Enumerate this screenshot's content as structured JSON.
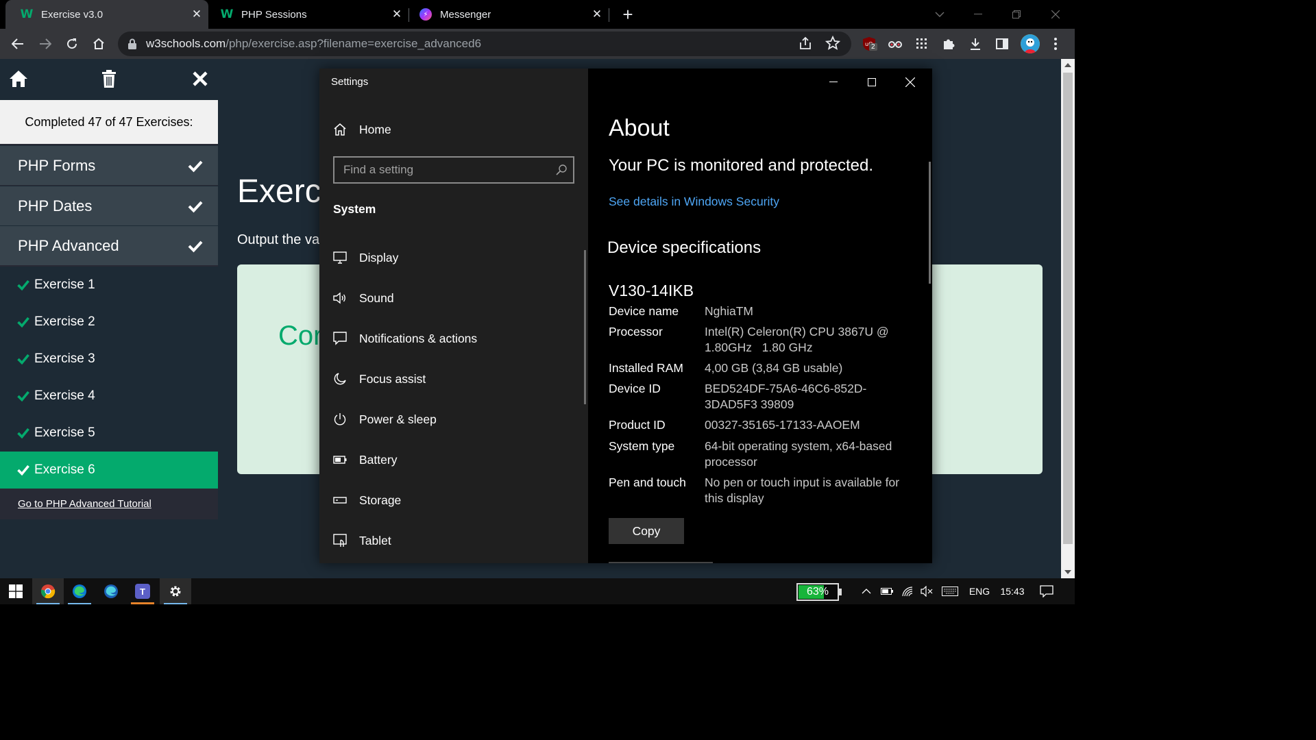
{
  "browser": {
    "tabs": [
      {
        "title": "Exercise v3.0",
        "favicon": "w3schools-icon",
        "active": true
      },
      {
        "title": "PHP Sessions",
        "favicon": "w3schools-icon",
        "active": false
      },
      {
        "title": "Messenger",
        "favicon": "messenger-icon",
        "active": false
      }
    ],
    "favicon_letter": "W",
    "url_host": "w3schools.com",
    "url_path": "/php/exercise.asp?filename=exercise_advanced6",
    "extension_badge": "2"
  },
  "sidebar": {
    "completed_text": "Completed 47 of 47 Exercises:",
    "categories": [
      {
        "label": "PHP Forms"
      },
      {
        "label": "PHP Dates"
      },
      {
        "label": "PHP Advanced"
      }
    ],
    "exercises": [
      {
        "label": "Exercise 1",
        "active": false
      },
      {
        "label": "Exercise 2",
        "active": false
      },
      {
        "label": "Exercise 3",
        "active": false
      },
      {
        "label": "Exercise 4",
        "active": false
      },
      {
        "label": "Exercise 5",
        "active": false
      },
      {
        "label": "Exercise 6",
        "active": true
      }
    ],
    "tutorial_link": "Go to PHP Advanced Tutorial"
  },
  "main": {
    "title_visible": "Exerc",
    "description_visible": "Output the va",
    "result_visible": "Cor"
  },
  "settings": {
    "window_title": "Settings",
    "home_label": "Home",
    "search_placeholder": "Find a setting",
    "section_header": "System",
    "nav_items": [
      {
        "label": "Display",
        "icon": "display-icon"
      },
      {
        "label": "Sound",
        "icon": "sound-icon"
      },
      {
        "label": "Notifications & actions",
        "icon": "notifications-icon"
      },
      {
        "label": "Focus assist",
        "icon": "focus-assist-icon"
      },
      {
        "label": "Power & sleep",
        "icon": "power-icon"
      },
      {
        "label": "Battery",
        "icon": "battery-icon"
      },
      {
        "label": "Storage",
        "icon": "storage-icon"
      },
      {
        "label": "Tablet",
        "icon": "tablet-icon"
      }
    ],
    "about": {
      "heading": "About",
      "status": "Your PC is monitored and protected.",
      "security_link": "See details in Windows Security",
      "specs_heading": "Device specifications",
      "model": "V130-14IKB",
      "specs": [
        {
          "key": "Device name",
          "value": "NghiaTM"
        },
        {
          "key": "Processor",
          "value": "Intel(R) Celeron(R) CPU 3867U @ 1.80GHz   1.80 GHz"
        },
        {
          "key": "Installed RAM",
          "value": "4,00 GB (3,84 GB usable)"
        },
        {
          "key": "Device ID",
          "value": "BED524DF-75A6-46C6-852D-3DAD5F3 39809"
        },
        {
          "key": "Product ID",
          "value": "00327-35165-17133-AAOEM"
        },
        {
          "key": "System type",
          "value": "64-bit operating system, x64-based processor"
        },
        {
          "key": "Pen and touch",
          "value": "No pen or touch input is available for this display"
        }
      ],
      "copy_button": "Copy"
    }
  },
  "taskbar": {
    "battery_percent": 63,
    "battery_text": "63%",
    "language": "ENG",
    "time": "15:43",
    "teams_letter": "T"
  },
  "colors": {
    "w3_green": "#04aa6d",
    "link_blue": "#4ea6f5",
    "sidebar_bg": "#282a35",
    "page_bg": "#1d2a35",
    "result_bg": "#d9eee1"
  }
}
